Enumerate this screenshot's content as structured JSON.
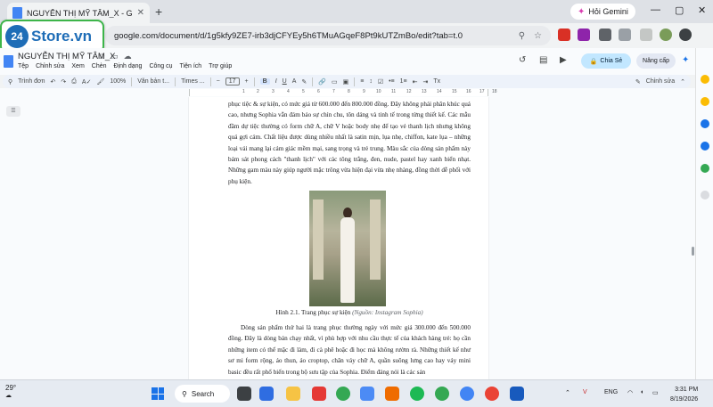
{
  "browser": {
    "tab_title": "NGUYỄN THỊ MỸ TÂM_X - Google",
    "new_tab_symbol": "+",
    "gemini_label": "Hỏi Gemini",
    "url": "google.com/document/d/1g5kfy9ZE7-irb3djCFYEy5h6TMuAGqeF8Pt9kUTZmBo/edit?tab=t.0",
    "window_controls": [
      "—",
      "▢",
      "✕"
    ]
  },
  "overlay_logo": {
    "number": "24",
    "text": "Store.vn"
  },
  "docs": {
    "title": "NGUYỄN THỊ MỸ TÂM_X",
    "menus": [
      "Tệp",
      "Chỉnh sửa",
      "Xem",
      "Chèn",
      "Định dạng",
      "Công cụ",
      "Tiện ích",
      "Trợ giúp"
    ],
    "share_label": "Chia Sẻ",
    "upgrade_label": "Nâng cấp",
    "toolbar": {
      "menus_label": "Trình đơn",
      "zoom": "100%",
      "style": "Văn bản t...",
      "font": "Times ...",
      "font_size": "17",
      "mode": "Chỉnh sửa"
    },
    "ruler_ticks": [
      "1",
      "2",
      "3",
      "4",
      "5",
      "6",
      "7",
      "8",
      "9",
      "10",
      "11",
      "12",
      "13",
      "14",
      "15",
      "16",
      "17",
      "18"
    ]
  },
  "document": {
    "paragraph1": "phục tiệc & sự kiện, có mức giá từ 600.000 đến 800.000 đồng. Đây không phải phân khúc quá cao, nhưng Sophia vẫn đảm bảo sự chỉn chu, tôn dáng và tinh tế trong từng thiết kế. Các mẫu đầm dự tiệc thường có form chữ A, chữ V hoặc body nhẹ để tạo vẻ thanh lịch nhưng không quá gợi cảm. Chất liệu được dùng nhiều nhất là satin mịn, lụa nhẹ, chiffon, kate lụa – những loại vải mang lại cảm giác mềm mại, sang trọng và trẻ trung. Màu sắc của dòng sản phẩm này bám sát phong cách \"thanh lịch\" với các tông trắng, đen, nude, pastel hay xanh biển nhạt. Những gam màu này giúp người mặc trông vừa hiện đại vừa nhẹ nhàng, đồng thời dễ phối với phụ kiện.",
    "caption_main": "Hình 2.1. Trang phục sự kiện",
    "caption_source": "(Nguồn: Instagram Sophia)",
    "paragraph2": "Dòng sản phẩm thứ hai là trang phục thường ngày với mức giá 300.000 đến 500.000 đồng. Đây là dòng bán chạy nhất, vì phù hợp với nhu cầu thực tế của khách hàng trẻ: họ cần những item có thể mặc đi làm, đi cà phê hoặc đi học mà không rườm rà. Những thiết kế như sơ mi form rộng, áo thun, áo croptop, chân váy chữ A, quần suông lưng cao hay váy mini basic đều rất phổ biến trong bộ sưu tập của Sophia. Điểm đáng nói là các sản"
  },
  "taskbar": {
    "temperature": "29°",
    "search_label": "Search",
    "language": "ENG",
    "time": "3:31 PM",
    "date": "8/19/2026"
  },
  "colors": {
    "accent": "#1a73e8",
    "share_bg": "#c2e7ff",
    "logo_green": "#3db54a",
    "logo_blue": "#1e6db7"
  }
}
